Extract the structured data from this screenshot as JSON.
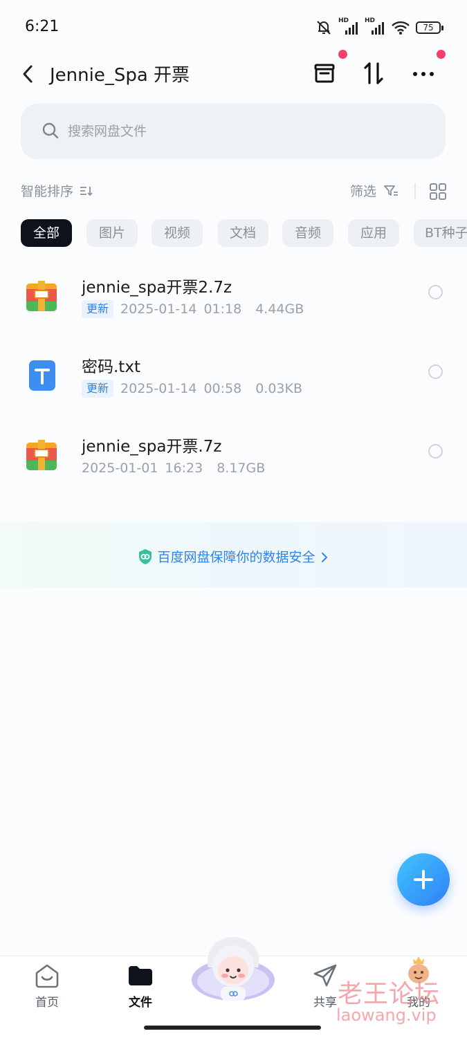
{
  "status_bar": {
    "time": "6:21",
    "signal_1": "HD",
    "signal_2": "HD",
    "battery": "75"
  },
  "header": {
    "title": "Jennie_Spa 开票"
  },
  "search": {
    "placeholder": "搜索网盘文件"
  },
  "sort": {
    "label": "智能排序",
    "filter_label": "筛选"
  },
  "chips": [
    "全部",
    "图片",
    "视频",
    "文档",
    "音频",
    "应用",
    "BT种子"
  ],
  "files": [
    {
      "name": "jennie_spa开票2.7z",
      "badge": "更新",
      "date": "2025-01-14",
      "time": "01:18",
      "size": "4.44GB",
      "icon": "archive-icon"
    },
    {
      "name": "密码.txt",
      "badge": "更新",
      "date": "2025-01-14",
      "time": "00:58",
      "size": "0.03KB",
      "icon": "text-file-icon"
    },
    {
      "name": "jennie_spa开票.7z",
      "badge": "",
      "date": "2025-01-01",
      "time": "16:23",
      "size": "8.17GB",
      "icon": "archive-icon"
    }
  ],
  "banner": {
    "text": "百度网盘保障你的数据安全"
  },
  "tabbar": {
    "home": "首页",
    "files": "文件",
    "share": "共享",
    "mine": "我的"
  },
  "watermark": {
    "cn": "老王论坛",
    "en": "laowang.vip"
  },
  "colors": {
    "accent": "#2f83e6",
    "dot": "#f2416b",
    "chip_active": "#0d121b"
  }
}
